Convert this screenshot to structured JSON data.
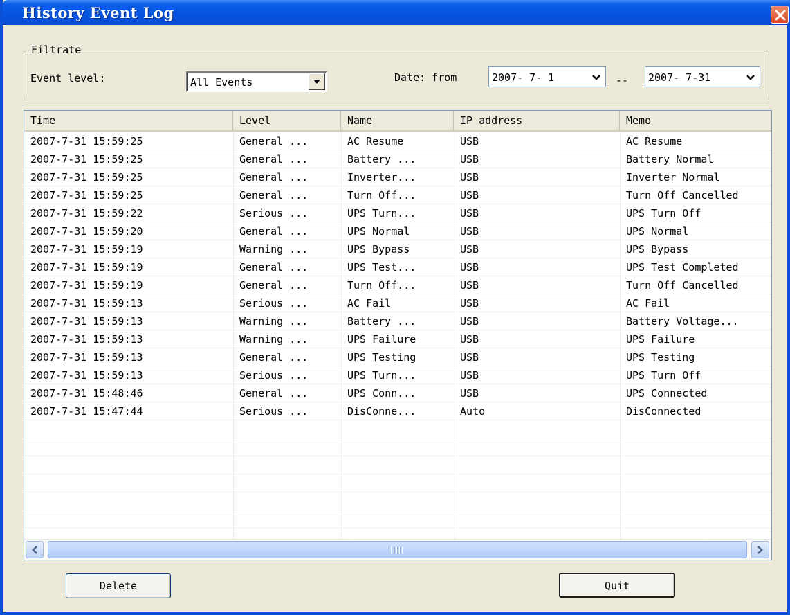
{
  "window": {
    "title": "History Event Log"
  },
  "filter": {
    "group_label": "Filtrate",
    "event_level_label": "Event level:",
    "event_level_value": "All Events",
    "date_label": "Date: from",
    "date_from": "2007- 7- 1",
    "date_separator": "--",
    "date_to": "2007- 7-31"
  },
  "table": {
    "columns": [
      "Time",
      "Level",
      "Name",
      "IP address",
      "Memo"
    ],
    "rows": [
      [
        "2007-7-31 15:59:25",
        "General ...",
        "AC Resume",
        "USB",
        "AC Resume"
      ],
      [
        "2007-7-31 15:59:25",
        "General ...",
        "Battery ...",
        "USB",
        "Battery Normal"
      ],
      [
        "2007-7-31 15:59:25",
        "General ...",
        "Inverter...",
        "USB",
        "Inverter Normal"
      ],
      [
        "2007-7-31 15:59:25",
        "General ...",
        "Turn Off...",
        "USB",
        "Turn Off Cancelled"
      ],
      [
        "2007-7-31 15:59:22",
        "Serious ...",
        "UPS Turn...",
        "USB",
        "UPS Turn Off"
      ],
      [
        "2007-7-31 15:59:20",
        "General ...",
        "UPS Normal",
        "USB",
        "UPS Normal"
      ],
      [
        "2007-7-31 15:59:19",
        "Warning ...",
        "UPS Bypass",
        "USB",
        "UPS Bypass"
      ],
      [
        "2007-7-31 15:59:19",
        "General ...",
        "UPS Test...",
        "USB",
        "UPS Test Completed"
      ],
      [
        "2007-7-31 15:59:19",
        "General ...",
        "Turn Off...",
        "USB",
        "Turn Off Cancelled"
      ],
      [
        "2007-7-31 15:59:13",
        "Serious ...",
        "AC Fail",
        "USB",
        "AC Fail"
      ],
      [
        "2007-7-31 15:59:13",
        "Warning ...",
        "Battery ...",
        "USB",
        "Battery Voltage..."
      ],
      [
        "2007-7-31 15:59:13",
        "Warning ...",
        "UPS Failure",
        "USB",
        "UPS Failure"
      ],
      [
        "2007-7-31 15:59:13",
        "General ...",
        "UPS Testing",
        "USB",
        "UPS Testing"
      ],
      [
        "2007-7-31 15:59:13",
        "Serious ...",
        "UPS Turn...",
        "USB",
        "UPS Turn Off"
      ],
      [
        "2007-7-31 15:48:46",
        "General ...",
        "UPS Conn...",
        "USB",
        "UPS Connected"
      ],
      [
        "2007-7-31 15:47:44",
        "Serious ...",
        "DisConne...",
        "Auto",
        "DisConnected"
      ]
    ]
  },
  "buttons": {
    "delete": "Delete",
    "quit": "Quit"
  }
}
